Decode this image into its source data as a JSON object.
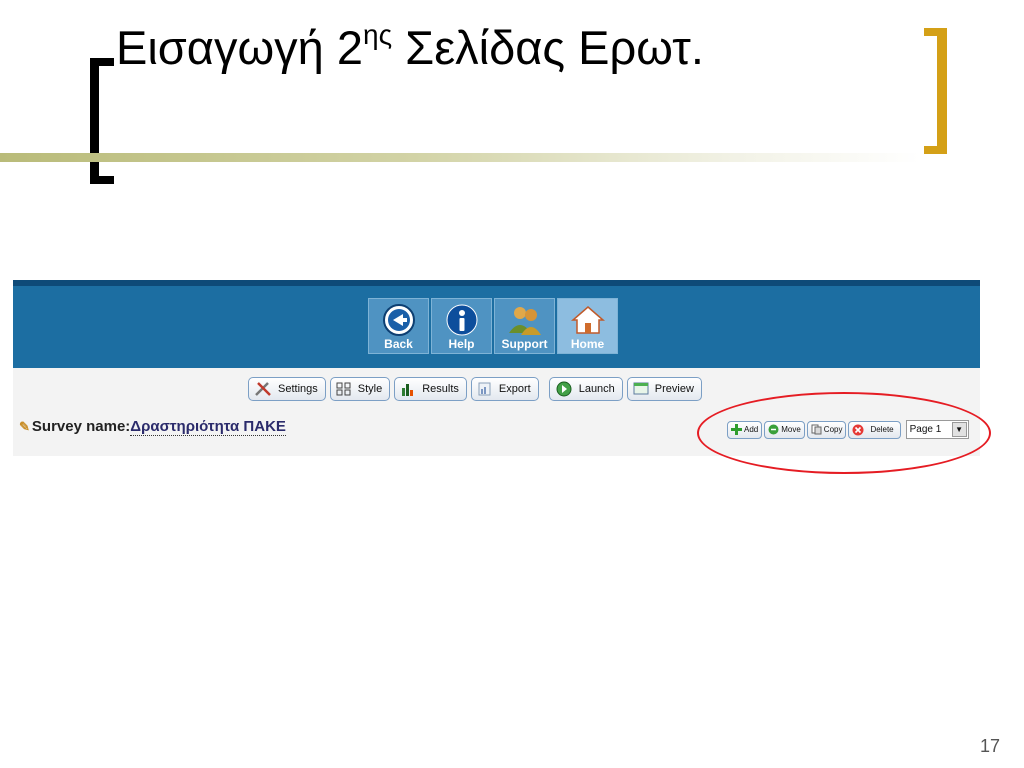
{
  "slide": {
    "title_main": "Εισαγωγή 2",
    "title_sup": "ης",
    "title_tail": " Σελίδας Ερωτ.",
    "number": "17"
  },
  "nav": {
    "back": "Back",
    "help": "Help",
    "support": "Support",
    "home": "Home"
  },
  "toolbar": {
    "settings": "Settings",
    "style": "Style",
    "results": "Results",
    "export": "Export",
    "launch": "Launch",
    "preview": "Preview"
  },
  "survey": {
    "label": "Survey name:",
    "value": "Δραστηριότητα ΠΑΚΕ"
  },
  "page_controls": {
    "add": "Add",
    "move": "Move",
    "copy": "Copy",
    "delete": "Delete",
    "page_select": "Page 1"
  },
  "colors": {
    "header_blue": "#1c6ea2",
    "bracket_gold": "#d4a017",
    "highlight_red": "#e51c23"
  }
}
